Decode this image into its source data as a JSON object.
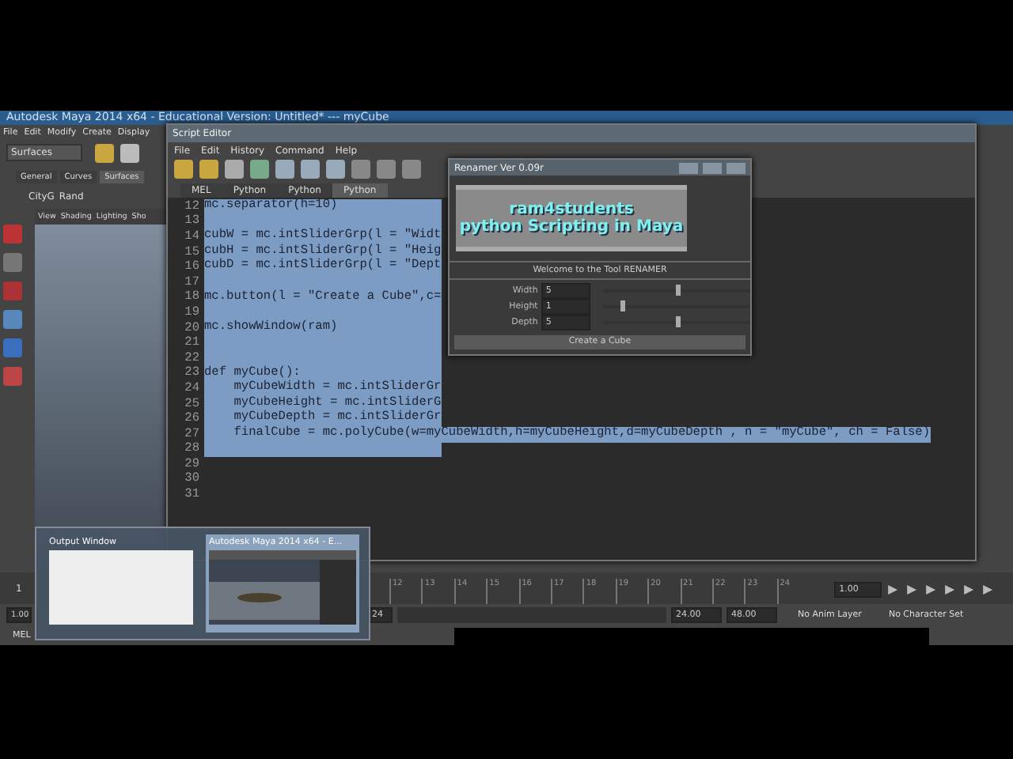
{
  "maya": {
    "title": "Autodesk Maya 2014 x64 - Educational Version: Untitled* --- myCube",
    "menu": [
      "File",
      "Edit",
      "Modify",
      "Create",
      "Display"
    ],
    "shelf_set": "Surfaces",
    "shelf_tabs": [
      {
        "label": "General",
        "selected": false
      },
      {
        "label": "Curves",
        "selected": false
      },
      {
        "label": "Surfaces",
        "selected": true
      }
    ],
    "shelf_items": [
      "CityG",
      "Rand"
    ],
    "panel_menu": [
      "View",
      "Shading",
      "Lighting",
      "Sho"
    ]
  },
  "script_editor": {
    "title": "Script Editor",
    "menu": [
      "File",
      "Edit",
      "History",
      "Command",
      "Help"
    ],
    "tabs": [
      {
        "label": "MEL",
        "selected": false
      },
      {
        "label": "Python",
        "selected": false
      },
      {
        "label": "Python",
        "selected": false
      },
      {
        "label": "Python",
        "selected": true
      }
    ],
    "lines": [
      {
        "number": "12",
        "text": "mc.separator(h=10)",
        "selected": true
      },
      {
        "number": "13",
        "selected": true
      },
      {
        "number": "14",
        "text": "cubW = mc.intSliderGrp(l = \"Widt",
        "selected": true
      },
      {
        "number": "15",
        "text": "cubH = mc.intSliderGrp(l = \"Heig",
        "selected": true
      },
      {
        "number": "16",
        "text": "cubD = mc.intSliderGrp(l = \"Dept",
        "selected": true
      },
      {
        "number": "17",
        "selected": true
      },
      {
        "number": "18",
        "text": "mc.button(l = \"Create a Cube\",c=",
        "selected": true
      },
      {
        "number": "19",
        "selected": true
      },
      {
        "number": "20",
        "text": "mc.showWindow(ram)",
        "selected": true
      },
      {
        "number": "21",
        "selected": true
      },
      {
        "number": "22",
        "selected": true
      },
      {
        "number": "23",
        "text": "def myCube():",
        "selected": true
      },
      {
        "number": "24",
        "text": "    myCubeWidth = mc.intSliderGr",
        "selected": true
      },
      {
        "number": "25",
        "text": "    myCubeHeight = mc.intSliderG",
        "selected": true
      },
      {
        "number": "26",
        "text": "    myCubeDepth = mc.intSliderGr",
        "selected": true
      },
      {
        "number": "27",
        "text": "    finalCube = mc.polyCube(w=myCubeWidth,h=myCubeHeight,d=myCubeDepth , n = \"myCube\", ch = False)",
        "selected": true
      },
      {
        "number": "28",
        "selected": true
      },
      {
        "number": "29",
        "selected": false
      },
      {
        "number": "30",
        "selected": false
      },
      {
        "number": "31",
        "selected": false
      }
    ]
  },
  "renamer": {
    "title": "Renamer Ver 0.09r",
    "banner": [
      "ram4students",
      "python Scripting in Maya"
    ],
    "welcome": "Welcome to the Tool RENAMER",
    "fields": [
      {
        "label": "Width",
        "value": "5",
        "level": 0.5
      },
      {
        "label": "Height",
        "value": "1",
        "level": 0.12
      },
      {
        "label": "Depth",
        "value": "5",
        "level": 0.5
      }
    ],
    "button": "Create a Cube"
  },
  "timeline": {
    "start_frame": "1",
    "ticks": [
      "12",
      "13",
      "14",
      "15",
      "16",
      "17",
      "18",
      "19",
      "20",
      "21",
      "22",
      "23",
      "24"
    ],
    "current": "1.00",
    "range_start": "1.00",
    "range_field": "24",
    "range_end": "24.00",
    "anim_end": "48.00",
    "anim_layer": "No Anim Layer",
    "character_set": "No Character Set",
    "command_label": "MEL"
  },
  "taskbar_preview": [
    {
      "title": "Output Window",
      "kind": "blank",
      "selected": false
    },
    {
      "title": "Autodesk Maya 2014 x64 - E...",
      "kind": "picture",
      "selected": true
    }
  ]
}
